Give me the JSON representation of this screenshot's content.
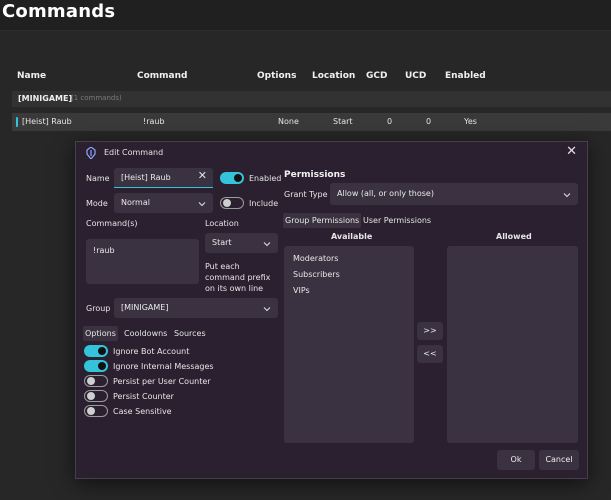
{
  "page": {
    "title": "Commands"
  },
  "table": {
    "headers": [
      "Name",
      "Command",
      "Options",
      "Location",
      "GCD",
      "UCD",
      "Enabled"
    ],
    "group": {
      "name": "[MINIGAME]",
      "count": "(1 commands)"
    },
    "row": {
      "name": "[Heist] Raub",
      "command": "!raub",
      "options": "None",
      "location": "Start",
      "gcd": "0",
      "ucd": "0",
      "enabled": "Yes"
    }
  },
  "dialog": {
    "title": "Edit Command",
    "name_label": "Name",
    "name_value": "[Heist] Raub",
    "enabled_label": "Enabled",
    "mode_label": "Mode",
    "mode_value": "Normal",
    "include_label": "Include",
    "commands_label": "Command(s)",
    "commands_value": "!raub",
    "location_label": "Location",
    "location_value": "Start",
    "location_hint": "Put each command prefix on its own line",
    "group_label": "Group",
    "group_value": "[MINIGAME]",
    "tabs": [
      "Options",
      "Cooldowns",
      "Sources"
    ],
    "options": [
      {
        "label": "Ignore Bot Account",
        "on": true
      },
      {
        "label": "Ignore Internal Messages",
        "on": true
      },
      {
        "label": "Persist per User Counter",
        "on": false
      },
      {
        "label": "Persist Counter",
        "on": false
      },
      {
        "label": "Case Sensitive",
        "on": false
      }
    ],
    "permissions": {
      "title": "Permissions",
      "grant_label": "Grant Type",
      "grant_value": "Allow (all, or only those)",
      "tabs": [
        "Group Permissions",
        "User Permissions"
      ],
      "available_label": "Available",
      "allowed_label": "Allowed",
      "available": [
        "Moderators",
        "Subscribers",
        "VIPs"
      ],
      "add_btn": ">>",
      "remove_btn": "<<"
    },
    "ok": "Ok",
    "cancel": "Cancel"
  },
  "colors": {
    "accent": "#35c3dc",
    "dialog_bg": "#2a2030",
    "field_bg": "#3b3241"
  }
}
